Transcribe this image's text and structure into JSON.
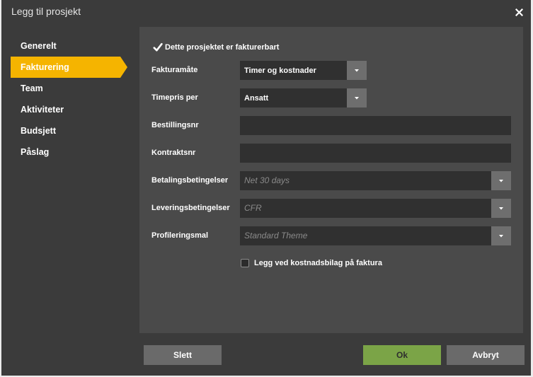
{
  "dialog": {
    "title": "Legg til prosjekt"
  },
  "sidebar": {
    "items": [
      {
        "label": "Generelt",
        "active": false
      },
      {
        "label": "Fakturering",
        "active": true
      },
      {
        "label": "Team",
        "active": false
      },
      {
        "label": "Aktiviteter",
        "active": false
      },
      {
        "label": "Budsjett",
        "active": false
      },
      {
        "label": "Påslag",
        "active": false
      }
    ]
  },
  "form": {
    "billable": {
      "label": "Dette prosjektet er fakturerbart",
      "checked": true
    },
    "invoicing_method": {
      "label": "Fakturamåte",
      "value": "Timer og kostnader"
    },
    "hourly_rate_per": {
      "label": "Timepris per",
      "value": "Ansatt"
    },
    "order_number": {
      "label": "Bestillingsnr",
      "value": ""
    },
    "contract_number": {
      "label": "Kontraktsnr",
      "value": ""
    },
    "payment_terms": {
      "label": "Betalingsbetingelser",
      "value": "",
      "placeholder": "Net 30 days"
    },
    "delivery_terms": {
      "label": "Leveringsbetingelser",
      "value": "",
      "placeholder": "CFR"
    },
    "profile_template": {
      "label": "Profileringsmal",
      "value": "",
      "placeholder": "Standard Theme"
    },
    "attach_cost_vouchers": {
      "label": "Legg ved kostnadsbilag på faktura",
      "checked": false
    }
  },
  "footer": {
    "delete_label": "Slett",
    "ok_label": "Ok",
    "cancel_label": "Avbryt"
  },
  "icons": {
    "close": "close-icon",
    "check": "check-icon",
    "dropdown": "chevron-down-icon"
  },
  "colors": {
    "dialog_bg": "#3b3b3b",
    "panel_bg": "#4a4a4a",
    "accent": "#f5b400",
    "ok_button": "#7ba447",
    "neutral_button": "#6a6a6a",
    "field_bg": "#303030",
    "dropdown_bg": "#6e6e6e"
  }
}
